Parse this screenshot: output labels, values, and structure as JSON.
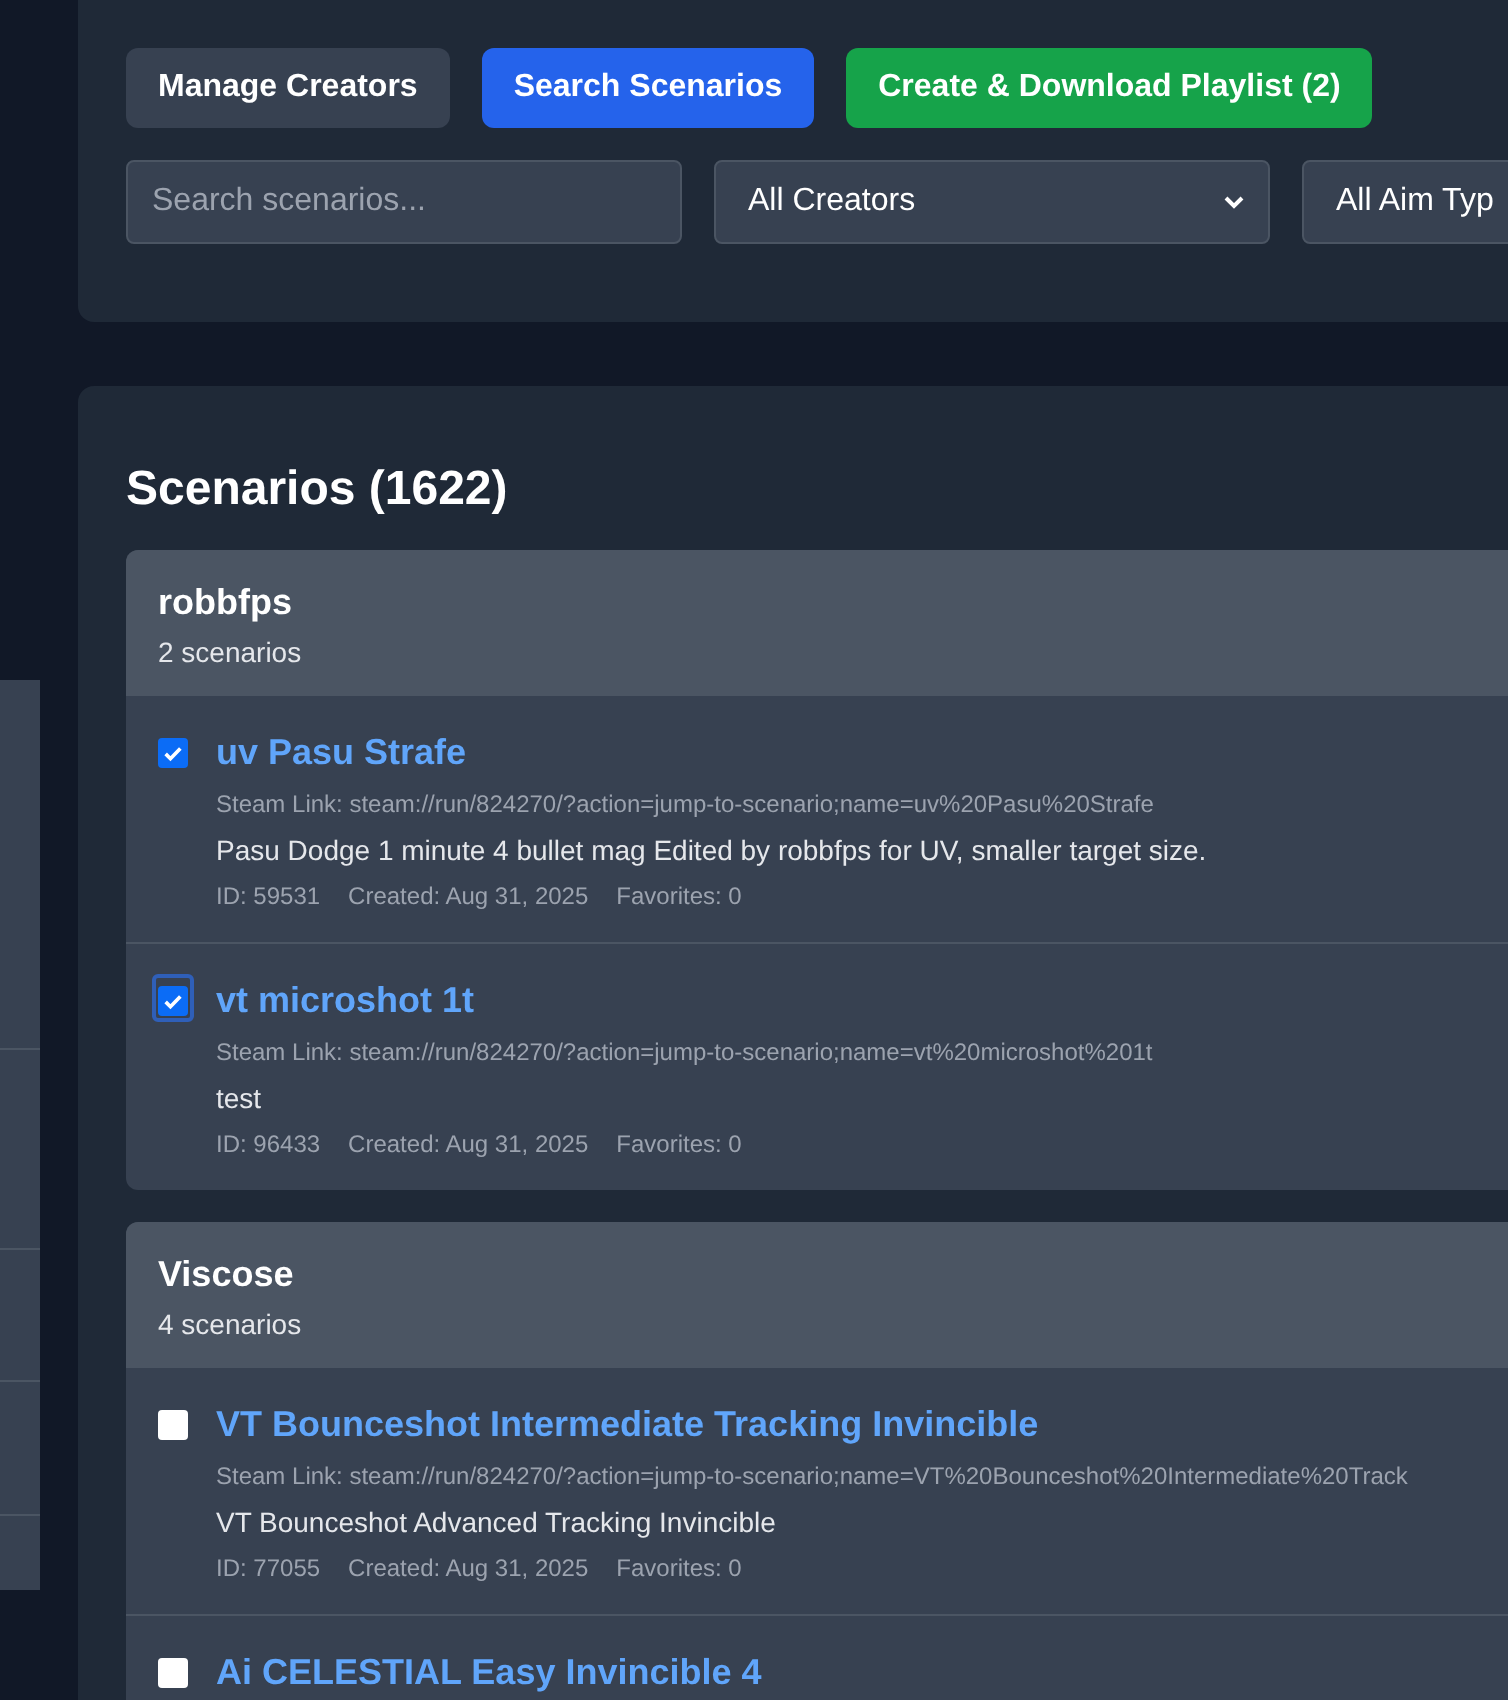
{
  "toolbar": {
    "buttons": [
      {
        "label": "Manage Creators",
        "kind": "neutral"
      },
      {
        "label": "Search Scenarios",
        "kind": "primary"
      },
      {
        "label": "Create & Download Playlist (2)",
        "kind": "success"
      }
    ]
  },
  "filters": {
    "search": {
      "placeholder": "Search scenarios..."
    },
    "creator_select": {
      "value": "All Creators"
    },
    "aim_type_select": {
      "value": "All Aim Typ"
    }
  },
  "scenarios": {
    "title": "Scenarios (1622)",
    "groups": [
      {
        "creator": "robbfps",
        "count": "2 scenarios",
        "items": [
          {
            "name": "uv Pasu Strafe",
            "checked": true,
            "focused": false,
            "steam_link": "Steam Link: steam://run/824270/?action=jump-to-scenario;name=uv%20Pasu%20Strafe",
            "description": "Pasu Dodge 1 minute 4 bullet mag Edited by robbfps for UV, smaller target size.",
            "id": "ID: 59531",
            "created": "Created: Aug 31, 2025",
            "favorites": "Favorites: 0"
          },
          {
            "name": "vt microshot 1t",
            "checked": true,
            "focused": true,
            "steam_link": "Steam Link: steam://run/824270/?action=jump-to-scenario;name=vt%20microshot%201t",
            "description": "test",
            "id": "ID: 96433",
            "created": "Created: Aug 31, 2025",
            "favorites": "Favorites: 0"
          }
        ]
      },
      {
        "creator": "Viscose",
        "count": "4 scenarios",
        "items": [
          {
            "name": "VT Bounceshot Intermediate Tracking Invincible",
            "checked": false,
            "steam_link": "Steam Link: steam://run/824270/?action=jump-to-scenario;name=VT%20Bounceshot%20Intermediate%20Track",
            "description": "VT Bounceshot Advanced Tracking Invincible",
            "id": "ID: 77055",
            "created": "Created: Aug 31, 2025",
            "favorites": "Favorites: 0"
          },
          {
            "name": "Ai CELESTIAL Easy Invincible 4",
            "checked": false
          }
        ]
      }
    ]
  }
}
